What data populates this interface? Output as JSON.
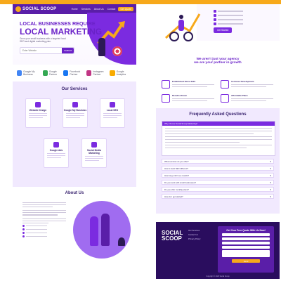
{
  "left": {
    "nav": {
      "logo": "SOCIAL SCOOP",
      "links": [
        "Home",
        "Services",
        "About Us",
        "Contact"
      ],
      "cta": "Get Quote"
    },
    "hero": {
      "line1": "LOCAL BUSINESSES REQUIRE",
      "line2": "LOCAL MARKETING",
      "sub": "Grow your small business with a targeted local SEO and digital marketing plan.",
      "search_placeholder": "Enter Website",
      "search_button": "SUBMIT"
    },
    "partners": [
      "Google My Business",
      "Google Partner",
      "Facebook Partner",
      "Instagram Partner",
      "Google Analytics"
    ],
    "services": {
      "heading": "Our Services",
      "cards": [
        "Website Design",
        "Google My Business",
        "Local SEO",
        "Google Ads",
        "Social Media Marketing"
      ]
    },
    "about": {
      "heading": "About Us"
    }
  },
  "right": {
    "hero": {
      "cta": "Get Started"
    },
    "partner": {
      "line1": "We aren't just your agency",
      "line2": "we are your partner in growth"
    },
    "features": [
      "Established Since 2015",
      "In-House Development",
      "Results-Driven",
      "Affordable Plans"
    ],
    "faq": {
      "heading": "Frequently Asked Questions",
      "open_question": "Why choose Social Scoop Marketing?",
      "items": [
        "What services do you offer?",
        "How is local SEO different?",
        "How long until I see results?",
        "Do you work with small businesses?",
        "Do you offer monthly plans?",
        "How do I get started?"
      ]
    },
    "footer": {
      "logo_line1": "SOCIAL",
      "logo_line2": "SCOOP",
      "links": [
        "Our Services",
        "Contact Us",
        "Privacy Policy"
      ],
      "form_title": "Get Your Free Quote With Us Now!",
      "form_button": "Send",
      "copyright": "Copyright © 2023 Social Scoop"
    }
  }
}
